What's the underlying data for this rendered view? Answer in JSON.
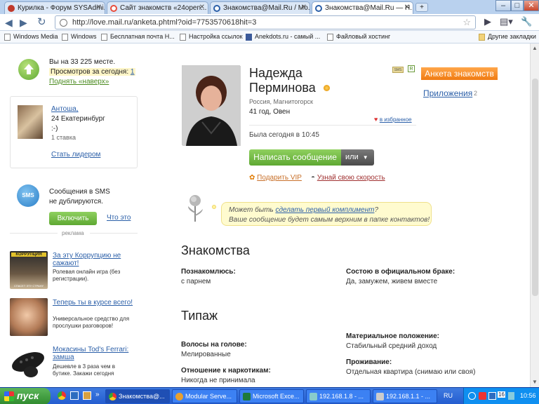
{
  "browser": {
    "tabs": [
      {
        "label": "Курилка - Форум SYSAdmi...",
        "color": "#c0392b"
      },
      {
        "label": "Сайт знакомств «24open...",
        "color": "#e74c3c"
      },
      {
        "label": "Знакомства@Mail.Ru / Мо...",
        "color": "#2b5fa8"
      },
      {
        "label": "Знакомства@Mail.Ru — Н...",
        "color": "#2b5fa8"
      }
    ],
    "url": "http://love.mail.ru/anketa.phtml?oid=7753570618hit=3",
    "bookmarks": [
      "Windows Media",
      "Windows",
      "Бесплатная почта Н...",
      "Настройка ссылок",
      "Anekdots.ru - самый ...",
      "Файловый хостинг"
    ],
    "other_bookmarks": "Другие закладки",
    "window_buttons": [
      "–",
      "□",
      "✕"
    ]
  },
  "sidebar": {
    "rank_text": "Вы на 33 225 месте.",
    "views_label": "Просмотров за сегодня:",
    "views_count": "1",
    "raise_link": "Поднять «наверх»",
    "leader": {
      "name": "Антоша,",
      "line2": "24 Екатеринбург",
      "line3": ":-)",
      "line4": "1 ставка"
    },
    "become_leader": "Стать лидером",
    "sms_icon": "SMS",
    "sms_text1": "Сообщения в SMS",
    "sms_text2": "не дублируются.",
    "enable_button": "Включить",
    "what_link": "Что это",
    "ads_label": "реклама",
    "ads": [
      {
        "title": "За эту Коррупцию не сажают!",
        "desc": "Ролевая онлайн игра (без регистрации).",
        "banner": "КОРРУПЦИЯ",
        "caption": "СПАСЕТ ЭТУ СТРАНУ"
      },
      {
        "title": "Теперь ты в курсе всего!",
        "desc": "Универсальное средство для прослушки разговоров!"
      },
      {
        "title": "Мокасины Tod's Ferrari: замша",
        "desc": "Дешевле в 3 раза чем в бутике. Закажи сегодня"
      }
    ]
  },
  "profile": {
    "name_line1": "Надежда",
    "name_line2": "Перминова",
    "location": "Россия, Магнитогорск",
    "age": "41 год, Овен",
    "favorites": "в избранное",
    "last_seen": "Была сегодня в 10:45",
    "write_button": "Написать сообщение",
    "or_button": "или",
    "vip_link": "Подарить VIP",
    "speed_link": "Узнай свою скорость",
    "sms_badge": "SMS",
    "r_badge": "R",
    "anketa_button": "Анкета знакомств",
    "apps_link": "Приложения",
    "apps_count": "2",
    "compliment_prefix": "Может быть ",
    "compliment_link": "сделать первый комплимент",
    "compliment_suffix": "?",
    "compliment_line2": "Ваше сообщение будет самым верхним в папке контактов!"
  },
  "acquaint": {
    "heading": "Знакомства",
    "f1_label": "Познакомлюсь:",
    "f1_value": "с парнем",
    "f2_label": "Состою в официальном браке:",
    "f2_value": "Да, замужем, живем вместе"
  },
  "type": {
    "heading": "Типаж",
    "hair_label": "Волосы на голове:",
    "hair_value": "Мелированные",
    "drugs_label": "Отношение к наркотикам:",
    "drugs_value": "Никогда не принимала",
    "money_label": "Материальное положение:",
    "money_value": "Стабильный средний доход",
    "living_label": "Проживание:",
    "living_value": "Отдельная квартира (снимаю или своя)"
  },
  "taskbar": {
    "start": "пуск",
    "tasks": [
      "Знакомства@...",
      "Modular Serve...",
      "Microsoft Exce...",
      "192.168.1.8 - ...",
      "192.168.1.1 - ..."
    ],
    "lang": "RU",
    "tray_num": "16",
    "time": "10:56"
  }
}
